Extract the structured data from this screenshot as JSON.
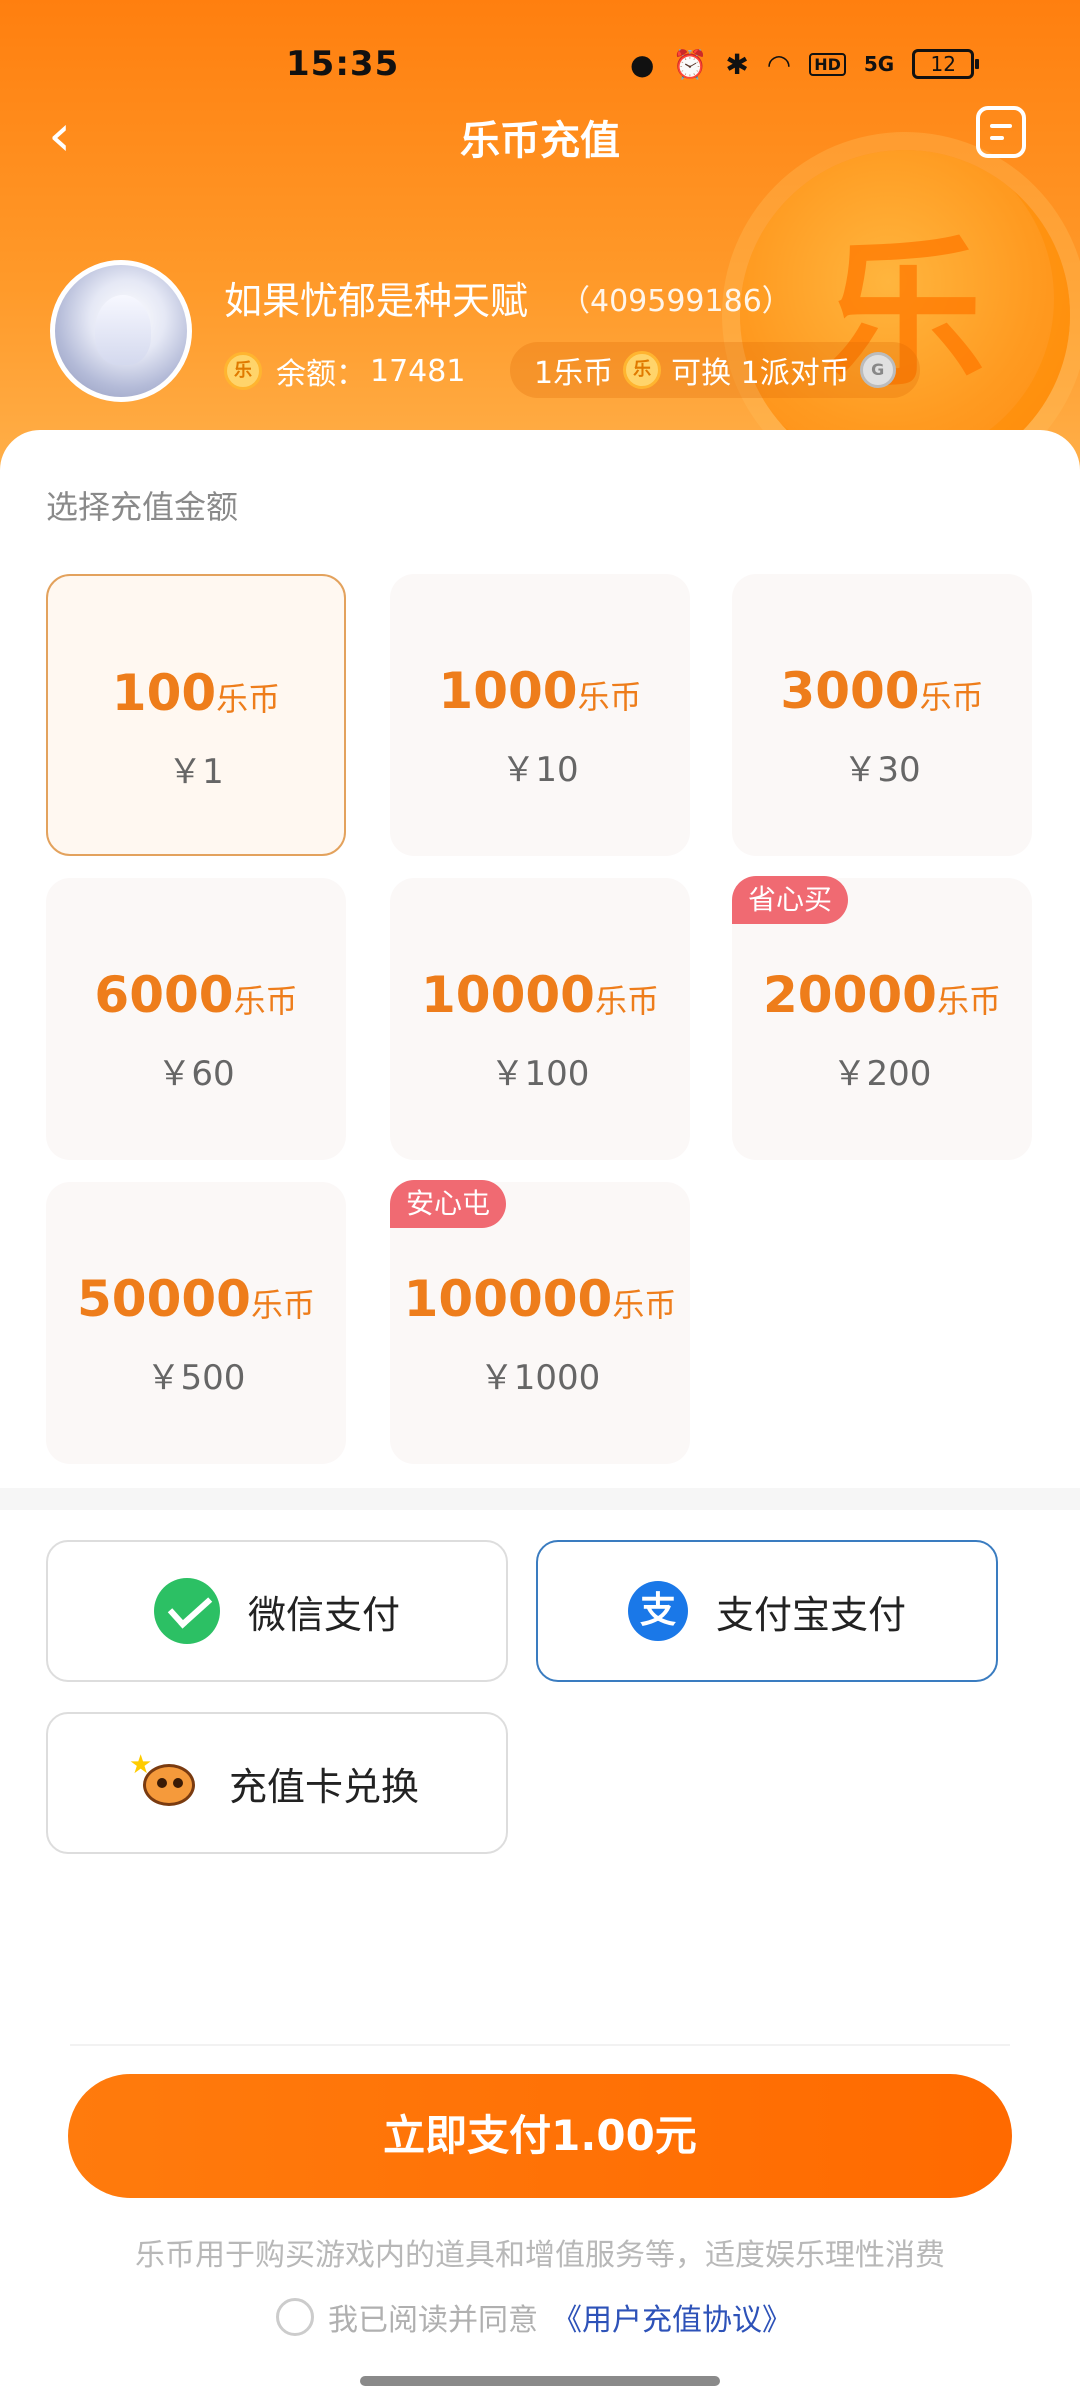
{
  "status_bar": {
    "time": "15:35",
    "icons": [
      "data-saver-icon",
      "alarm-icon",
      "bluetooth-icon",
      "wifi-icon",
      "hd-icon",
      "5g-signal-icon",
      "battery-icon"
    ],
    "hd": "HD",
    "signal": "5G",
    "battery": "12"
  },
  "nav": {
    "title": "乐币充值",
    "back_glyph": "‹"
  },
  "user": {
    "name": "如果忧郁是种天赋",
    "id": "（409599186）",
    "balance_label": "余额：",
    "balance_value": "17481",
    "coin_glyph": "乐",
    "rate_left": "1乐币",
    "rate_mid": "可换 1派对币",
    "party_glyph": "G"
  },
  "section_label": "选择充值金额",
  "amounts": [
    {
      "coins": "100",
      "unit": "乐币",
      "price": "￥1",
      "tag": ""
    },
    {
      "coins": "1000",
      "unit": "乐币",
      "price": "￥10",
      "tag": ""
    },
    {
      "coins": "3000",
      "unit": "乐币",
      "price": "￥30",
      "tag": ""
    },
    {
      "coins": "6000",
      "unit": "乐币",
      "price": "￥60",
      "tag": ""
    },
    {
      "coins": "10000",
      "unit": "乐币",
      "price": "￥100",
      "tag": ""
    },
    {
      "coins": "20000",
      "unit": "乐币",
      "price": "￥200",
      "tag": "省心买"
    },
    {
      "coins": "50000",
      "unit": "乐币",
      "price": "￥500",
      "tag": ""
    },
    {
      "coins": "100000",
      "unit": "乐币",
      "price": "￥1000",
      "tag": "安心屯"
    }
  ],
  "payment": {
    "wechat": "微信支付",
    "alipay": "支付宝支付",
    "alipay_glyph": "支",
    "card": "充值卡兑换",
    "selected": "alipay"
  },
  "pay_now": "立即支付1.00元",
  "notice": "乐币用于购买游戏内的道具和增值服务等，适度娱乐理性消费",
  "agreement": {
    "text": "我已阅读并同意",
    "link": "《用户充值协议》"
  },
  "colors": {
    "header_start": "#ff7f0f",
    "accent": "#ee7d1b",
    "pay_button": "#ff6a00",
    "tag": "#f06a72",
    "link": "#2d52b8",
    "selected_border": "#3a7cc0"
  }
}
